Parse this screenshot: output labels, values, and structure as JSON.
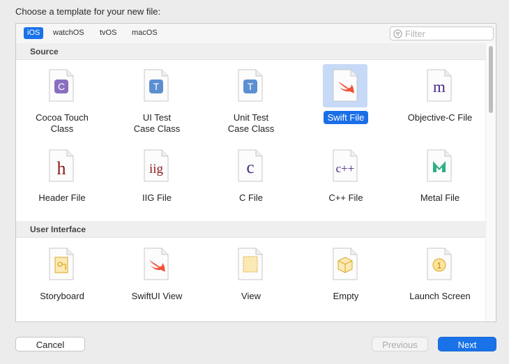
{
  "dialog": {
    "heading": "Choose a template for your new file:"
  },
  "tabs": [
    {
      "label": "iOS",
      "selected": true
    },
    {
      "label": "watchOS",
      "selected": false
    },
    {
      "label": "tvOS",
      "selected": false
    },
    {
      "label": "macOS",
      "selected": false
    }
  ],
  "filter": {
    "placeholder": "Filter",
    "icon": "filter-icon"
  },
  "sections": [
    {
      "title": "Source",
      "items": [
        {
          "label": "Cocoa Touch Class",
          "label_lines": [
            "Cocoa Touch",
            "Class"
          ],
          "glyph": "C",
          "icon": "cocoa-touch-class-icon"
        },
        {
          "label": "UI Test Case Class",
          "label_lines": [
            "UI Test",
            "Case Class"
          ],
          "glyph": "T",
          "icon": "ui-test-case-class-icon"
        },
        {
          "label": "Unit Test Case Class",
          "label_lines": [
            "Unit Test",
            "Case Class"
          ],
          "glyph": "T",
          "icon": "unit-test-case-class-icon"
        },
        {
          "label": "Swift File",
          "label_lines": [
            "Swift File"
          ],
          "glyph": "",
          "icon": "swift-file-icon",
          "selected": true
        },
        {
          "label": "Objective-C File",
          "label_lines": [
            "Objective-C File"
          ],
          "glyph": "m",
          "icon": "objective-c-file-icon"
        },
        {
          "label": "Header File",
          "label_lines": [
            "Header File"
          ],
          "glyph": "h",
          "icon": "header-file-icon"
        },
        {
          "label": "IIG File",
          "label_lines": [
            "IIG File"
          ],
          "glyph": "iig",
          "icon": "iig-file-icon"
        },
        {
          "label": "C File",
          "label_lines": [
            "C File"
          ],
          "glyph": "c",
          "icon": "c-file-icon"
        },
        {
          "label": "C++ File",
          "label_lines": [
            "C++ File"
          ],
          "glyph": "c++",
          "icon": "cpp-file-icon"
        },
        {
          "label": "Metal File",
          "label_lines": [
            "Metal File"
          ],
          "glyph": "",
          "icon": "metal-file-icon"
        }
      ]
    },
    {
      "title": "User Interface",
      "items": [
        {
          "label": "Storyboard",
          "label_lines": [
            "Storyboard"
          ],
          "glyph": "",
          "icon": "storyboard-icon"
        },
        {
          "label": "SwiftUI View",
          "label_lines": [
            "SwiftUI View"
          ],
          "glyph": "",
          "icon": "swiftui-view-icon"
        },
        {
          "label": "View",
          "label_lines": [
            "View"
          ],
          "glyph": "",
          "icon": "view-icon"
        },
        {
          "label": "Empty",
          "label_lines": [
            "Empty"
          ],
          "glyph": "",
          "icon": "empty-icon"
        },
        {
          "label": "Launch Screen",
          "label_lines": [
            "Launch Screen"
          ],
          "glyph": "1",
          "icon": "launch-screen-icon"
        }
      ]
    }
  ],
  "buttons": {
    "cancel": "Cancel",
    "previous": "Previous",
    "next": "Next"
  },
  "colors": {
    "accent": "#1a72e8",
    "selection_bg": "#c6d9f6",
    "tint_purple": "#8a6fc0",
    "tint_blue": "#5b8fd1",
    "swift_orange": "#f05138",
    "header_red": "#8b1a1a",
    "objc_purple": "#4a2a86",
    "metal_green": "#2fae84"
  }
}
